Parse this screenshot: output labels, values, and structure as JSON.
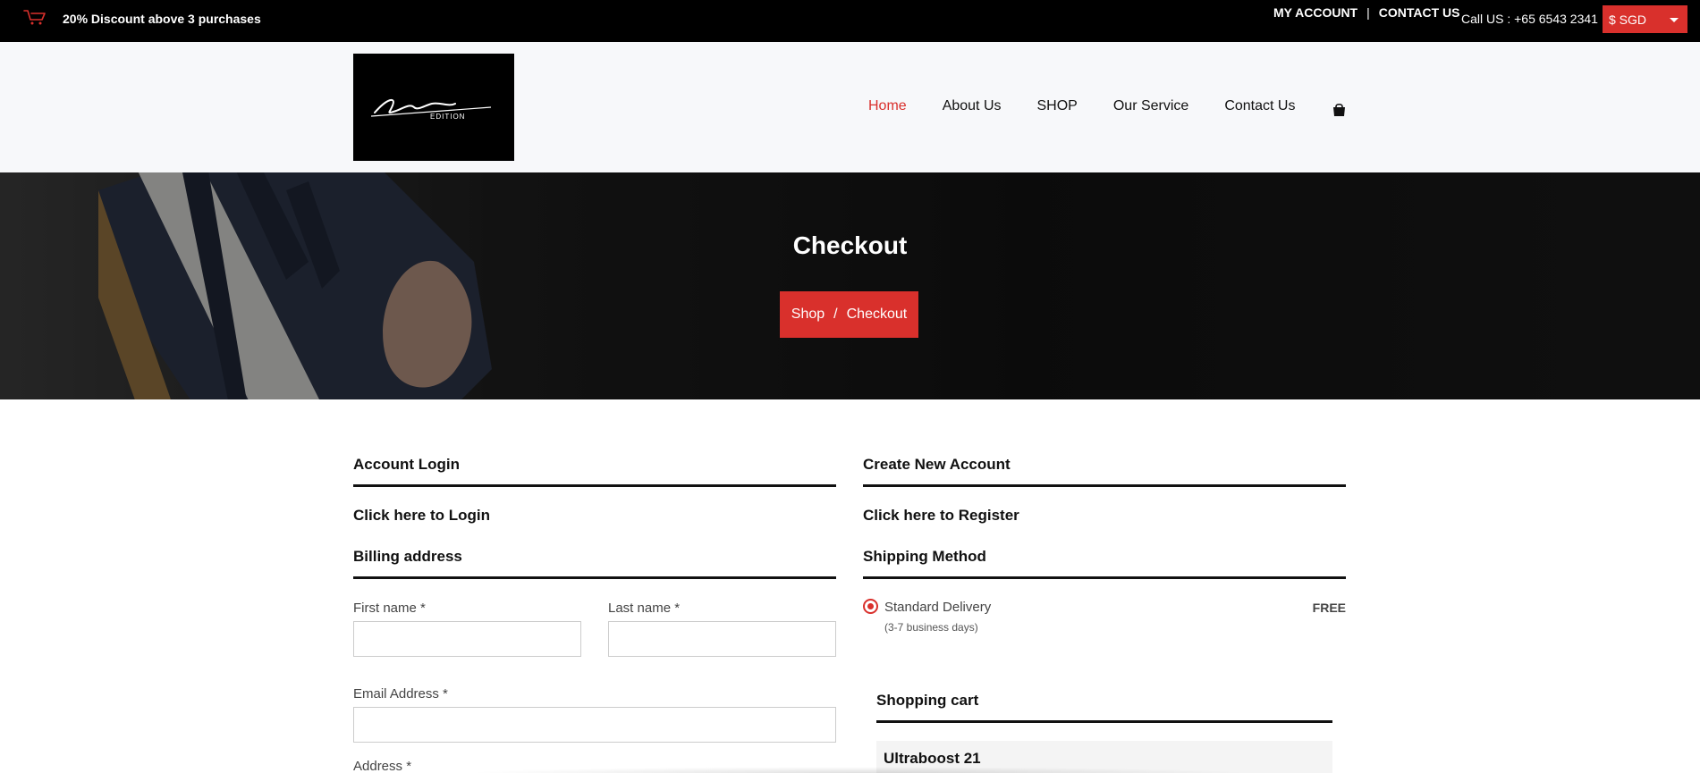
{
  "topbar": {
    "promo": "20% Discount above 3 purchases",
    "my_account": "MY ACCOUNT",
    "separator": "|",
    "contact": "CONTACT US",
    "call": "Call US : +65 6543 2341",
    "currency": "$ SGD",
    "icons": {
      "cart": "cart-icon",
      "caret": "chevron-down-icon"
    }
  },
  "header": {
    "logo": {
      "script": "Limited",
      "word": "EDITION"
    },
    "nav": [
      "Home",
      "About Us",
      "SHOP",
      "Our Service",
      "Contact Us"
    ],
    "active_nav": "Home",
    "bag_icon": "shopping-bag-icon"
  },
  "banner": {
    "title": "Checkout",
    "breadcrumb": [
      "Shop",
      "/",
      "Checkout"
    ]
  },
  "account": {
    "login_title": "Account Login",
    "login_link": "Click here to Login",
    "register_title": "Create New Account",
    "register_link": "Click here to Register"
  },
  "billing": {
    "title": "Billing address",
    "first_name_label": "First name *",
    "last_name_label": "Last name *",
    "email_label": "Email Address *",
    "address_label": "Address *"
  },
  "shipping": {
    "title": "Shipping Method",
    "option_name": "Standard Delivery",
    "option_sub": "(3-7 business days)",
    "option_price": "FREE"
  },
  "cart": {
    "title": "Shopping cart",
    "items": [
      "Ultraboost 21"
    ]
  },
  "colors": {
    "accent": "#d9302c",
    "topbar": "#000000",
    "header_bg": "#f7f8fa"
  }
}
